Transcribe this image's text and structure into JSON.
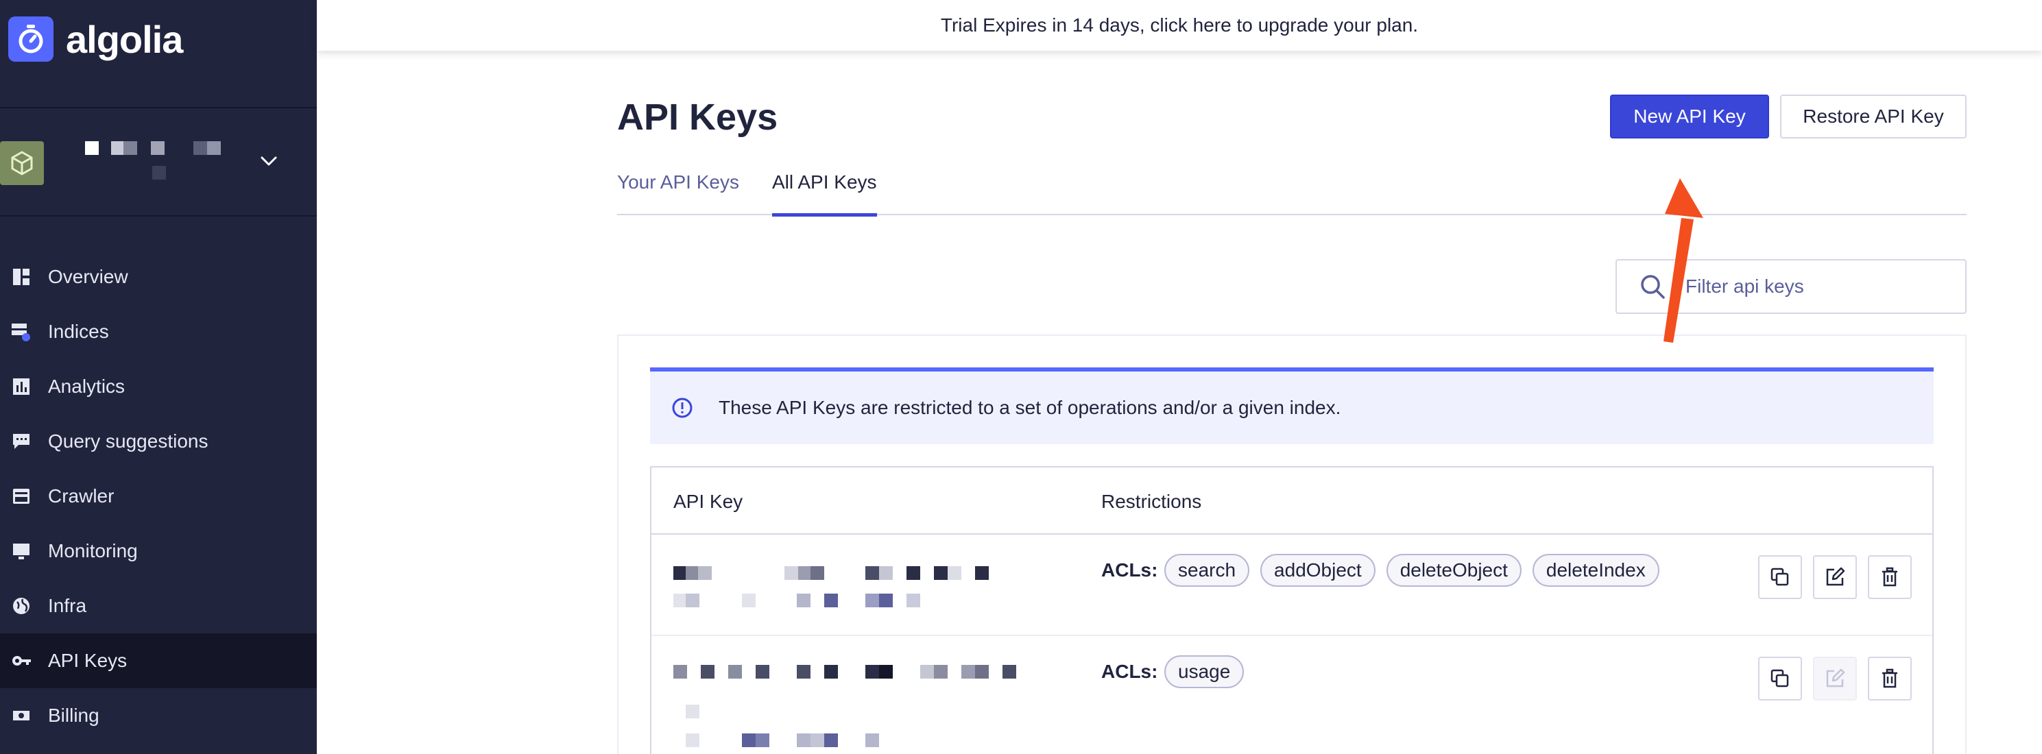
{
  "brand": {
    "name": "algolia",
    "color": "#5468ff"
  },
  "sidebar": {
    "bg": "#21243d",
    "items": [
      {
        "label": "Overview",
        "icon": "overview-icon",
        "active": false
      },
      {
        "label": "Indices",
        "icon": "indices-icon",
        "active": false
      },
      {
        "label": "Analytics",
        "icon": "analytics-icon",
        "active": false
      },
      {
        "label": "Query suggestions",
        "icon": "query-suggestions-icon",
        "active": false
      },
      {
        "label": "Crawler",
        "icon": "crawler-icon",
        "active": false
      },
      {
        "label": "Monitoring",
        "icon": "monitoring-icon",
        "active": false
      },
      {
        "label": "Infra",
        "icon": "infra-icon",
        "active": false
      },
      {
        "label": "API Keys",
        "icon": "key-icon",
        "active": true
      },
      {
        "label": "Billing",
        "icon": "billing-icon",
        "active": false
      }
    ]
  },
  "banner": {
    "text": "Trial Expires in 14 days, click here to upgrade your plan."
  },
  "page": {
    "title": "API Keys",
    "new_button": "New API Key",
    "restore_button": "Restore API Key",
    "tabs": [
      {
        "label": "Your API Keys",
        "active": false
      },
      {
        "label": "All API Keys",
        "active": true
      }
    ]
  },
  "search": {
    "placeholder": "Filter api keys"
  },
  "notice": {
    "text": "These API Keys are restricted to a set of operations and/or a given index."
  },
  "table": {
    "headers": {
      "key": "API Key",
      "restrictions": "Restrictions"
    },
    "acl_label": "ACLs:",
    "rows": [
      {
        "acls": [
          "search",
          "addObject",
          "deleteObject",
          "deleteIndex"
        ],
        "edit_enabled": true
      },
      {
        "acls": [
          "usage"
        ],
        "edit_enabled": false
      }
    ]
  },
  "colors": {
    "accent": "#3a46d8",
    "annotation_arrow": "#f24e1e"
  }
}
